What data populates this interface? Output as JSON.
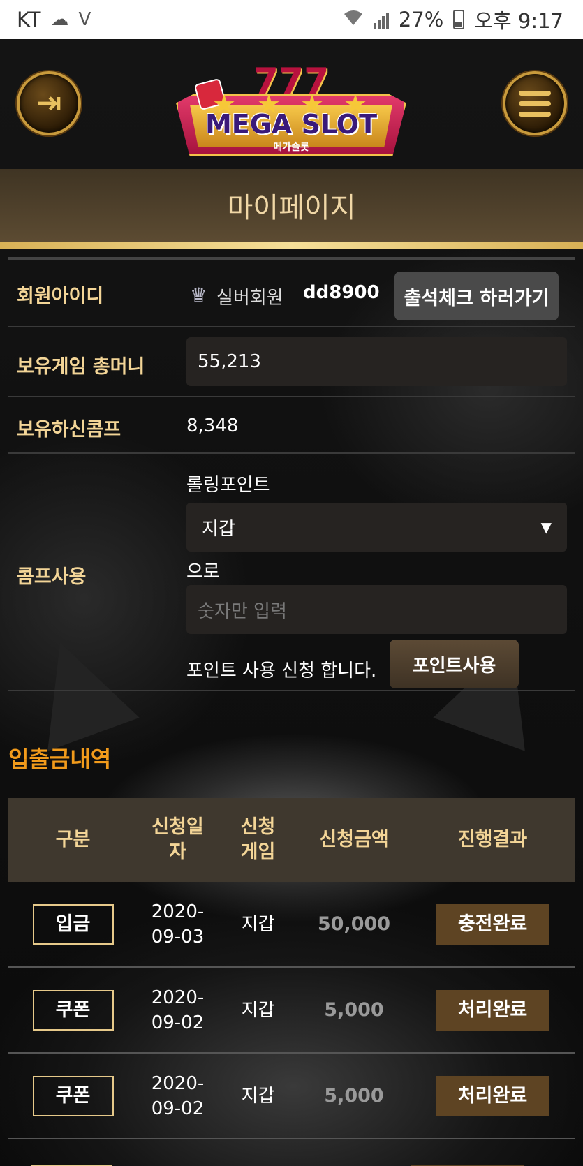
{
  "status_bar": {
    "carrier": "KT",
    "battery_pct": "27%",
    "time": "오후 9:17"
  },
  "header": {
    "logo_text": "MEGA SLOT",
    "logo_sub": "메가슬롯",
    "logo_number": "777"
  },
  "page_title": "마이페이지",
  "member": {
    "id_label": "회원아이디",
    "grade": "실버회원",
    "user_id": "dd8900",
    "attendance_button": "출석체크 하러가기"
  },
  "money": {
    "label": "보유게임 총머니",
    "value": "55,213"
  },
  "comp": {
    "label": "보유하신콤프",
    "value": "8,348"
  },
  "comp_use": {
    "label": "콤프사용",
    "source_label": "롤링포인트",
    "select_value": "지갑",
    "to_label": "으로",
    "amount_placeholder": "숫자만 입력",
    "request_text": "포인트 사용 신청 합니다.",
    "submit_button": "포인트사용"
  },
  "history": {
    "title": "입출금내역",
    "headers": {
      "type": "구분",
      "date": "신청일\n자",
      "game": "신청\n게임",
      "amount": "신청금액",
      "result": "진행결과"
    },
    "rows": [
      {
        "type": "입금",
        "date": "2020-\n09-03",
        "game": "지갑",
        "amount": "50,000",
        "result": "충전완료"
      },
      {
        "type": "쿠폰",
        "date": "2020-\n09-02",
        "game": "지갑",
        "amount": "5,000",
        "result": "처리완료"
      },
      {
        "type": "쿠폰",
        "date": "2020-\n09-02",
        "game": "지갑",
        "amount": "5,000",
        "result": "처리완료"
      }
    ]
  },
  "colors": {
    "gold_label": "#f3d597",
    "section_orange": "#f29b1b",
    "result_brown": "#5e4423"
  }
}
